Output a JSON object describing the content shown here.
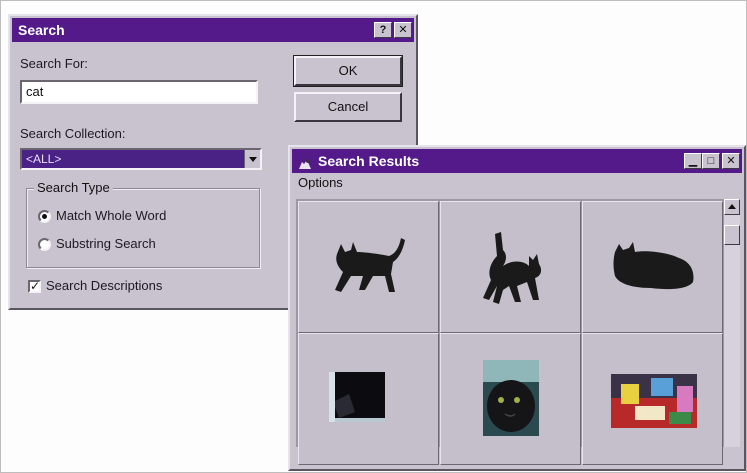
{
  "search_dialog": {
    "title": "Search",
    "help_glyph": "?",
    "close_glyph": "✕",
    "search_for_label": "Search For:",
    "search_for_value": "cat",
    "ok_label": "OK",
    "cancel_label": "Cancel",
    "collection_label": "Search Collection:",
    "collection_value": "<ALL>",
    "search_type_label": "Search Type",
    "match_whole_word_label": "Match Whole Word",
    "substring_search_label": "Substring Search",
    "search_type_selected": "Match Whole Word",
    "search_descriptions_label": "Search Descriptions",
    "search_descriptions_checked": true,
    "check_glyph": "✓"
  },
  "results_window": {
    "title": "Search Results",
    "title_icon": "pets-icon",
    "menu_options_label": "Options",
    "minimize_glyph": "▁",
    "maximize_glyph": "□",
    "close_glyph": "✕",
    "thumbnails": [
      {
        "kind": "cat-silhouette-walking"
      },
      {
        "kind": "cat-silhouette-arched"
      },
      {
        "kind": "cat-silhouette-lying"
      },
      {
        "kind": "photo-dark-cat"
      },
      {
        "kind": "photo-cat-face"
      },
      {
        "kind": "photo-colorful-scene"
      }
    ]
  },
  "colors": {
    "titlebar": "#541a8a",
    "dialog_face": "#c9c3cf",
    "desktop": "#fdfdfd"
  }
}
